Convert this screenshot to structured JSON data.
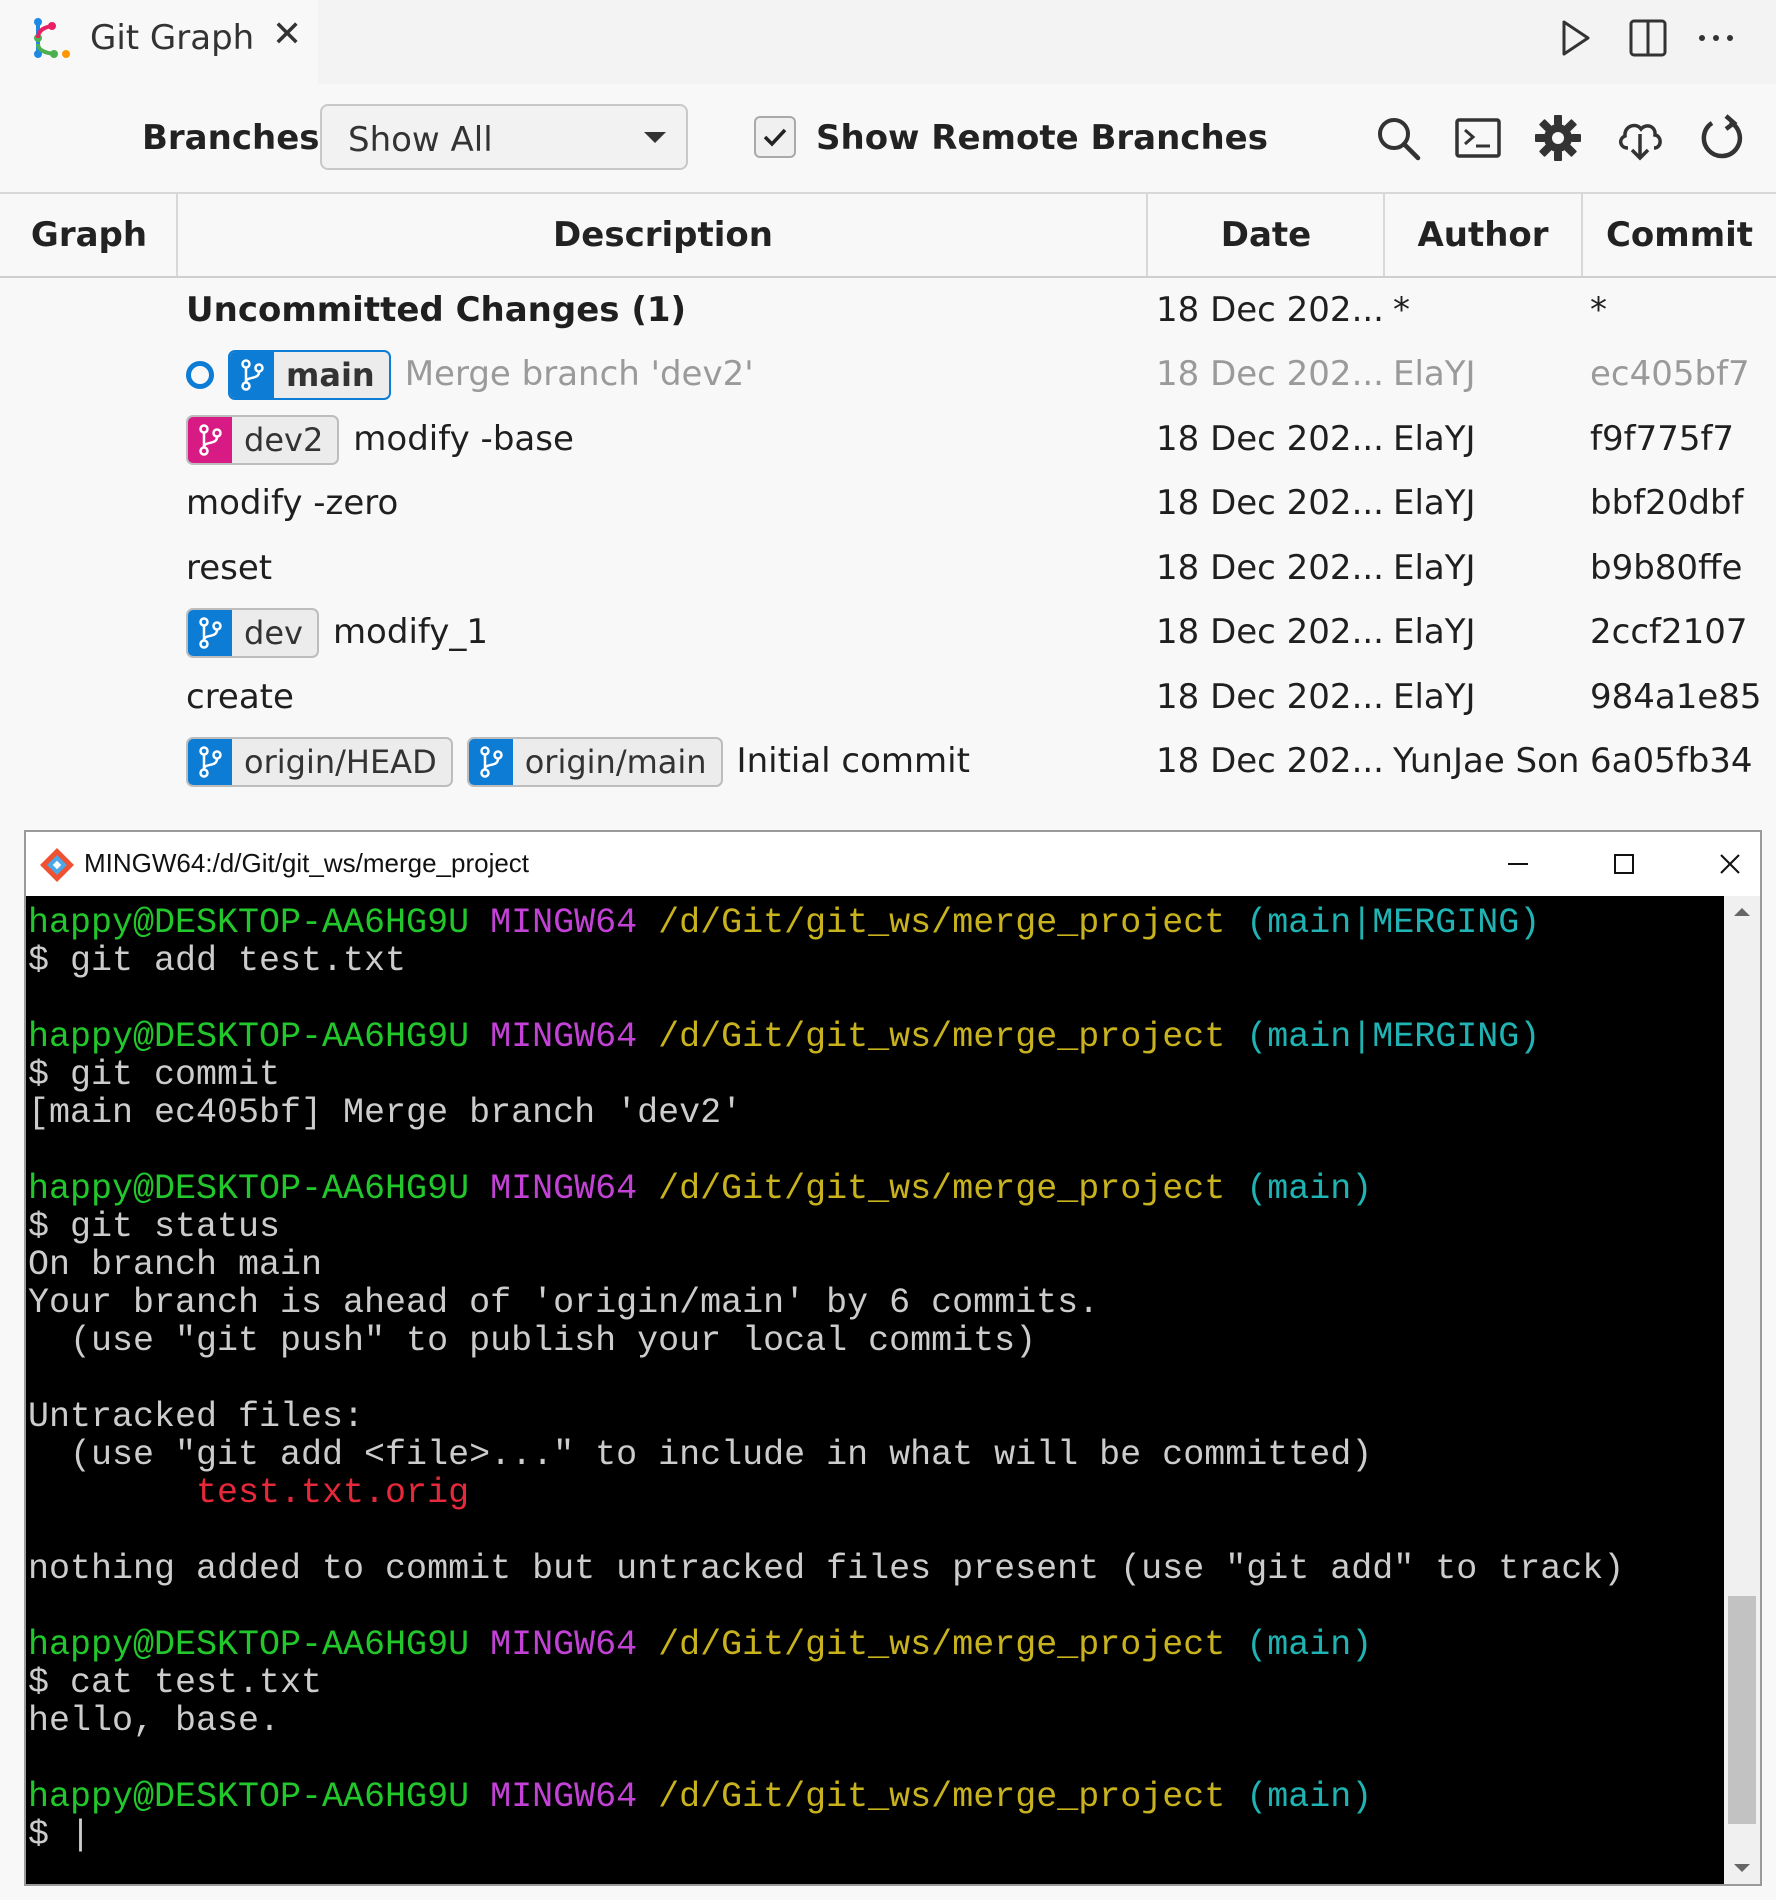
{
  "tab": {
    "title": "Git Graph"
  },
  "controls": {
    "branches_label": "Branches:",
    "branch_select_value": "Show All",
    "show_remote_label": "Show Remote Branches",
    "show_remote_checked": true
  },
  "table": {
    "headers": {
      "graph": "Graph",
      "description": "Description",
      "date": "Date",
      "author": "Author",
      "commit": "Commit"
    },
    "rows": [
      {
        "description": "Uncommitted Changes (1)",
        "date": "18 Dec 202...",
        "author": "*",
        "commit": "*"
      },
      {
        "refs": [
          "main"
        ],
        "description": "Merge branch 'dev2'",
        "date": "18 Dec 202...",
        "author": "ElaYJ",
        "commit": "ec405bf7"
      },
      {
        "refs": [
          "dev2"
        ],
        "description": "modify -base",
        "date": "18 Dec 202...",
        "author": "ElaYJ",
        "commit": "f9f775f7"
      },
      {
        "description": "modify -zero",
        "date": "18 Dec 202...",
        "author": "ElaYJ",
        "commit": "bbf20dbf"
      },
      {
        "description": "reset",
        "date": "18 Dec 202...",
        "author": "ElaYJ",
        "commit": "b9b80ffe"
      },
      {
        "refs": [
          "dev"
        ],
        "description": "modify_1",
        "date": "18 Dec 202...",
        "author": "ElaYJ",
        "commit": "2ccf2107"
      },
      {
        "description": "create",
        "date": "18 Dec 202...",
        "author": "ElaYJ",
        "commit": "984a1e85"
      },
      {
        "refs": [
          "origin/HEAD",
          "origin/main"
        ],
        "description": "Initial commit",
        "date": "18 Dec 202...",
        "author": "YunJae Son",
        "commit": "6a05fb34"
      }
    ]
  },
  "terminal": {
    "title": "MINGW64:/d/Git/git_ws/merge_project",
    "prompt": {
      "user": "happy@DESKTOP-AA6HG9U",
      "shell": "MINGW64",
      "path": "/d/Git/git_ws/merge_project"
    },
    "lines": [
      {
        "kind": "prompt",
        "branch": "(main|MERGING)"
      },
      {
        "kind": "text",
        "text": "$ git add test.txt"
      },
      {
        "kind": "blank"
      },
      {
        "kind": "prompt",
        "branch": "(main|MERGING)"
      },
      {
        "kind": "text",
        "text": "$ git commit"
      },
      {
        "kind": "text",
        "text": "[main ec405bf] Merge branch 'dev2'"
      },
      {
        "kind": "blank"
      },
      {
        "kind": "prompt",
        "branch": "(main)"
      },
      {
        "kind": "text",
        "text": "$ git status"
      },
      {
        "kind": "text",
        "text": "On branch main"
      },
      {
        "kind": "text",
        "text": "Your branch is ahead of 'origin/main' by 6 commits."
      },
      {
        "kind": "text",
        "text": "  (use \"git push\" to publish your local commits)"
      },
      {
        "kind": "blank"
      },
      {
        "kind": "text",
        "text": "Untracked files:"
      },
      {
        "kind": "text",
        "text": "  (use \"git add <file>...\" to include in what will be committed)"
      },
      {
        "kind": "red",
        "text": "        test.txt.orig"
      },
      {
        "kind": "blank"
      },
      {
        "kind": "text",
        "text": "nothing added to commit but untracked files present (use \"git add\" to track)"
      },
      {
        "kind": "blank"
      },
      {
        "kind": "prompt",
        "branch": "(main)"
      },
      {
        "kind": "text",
        "text": "$ cat test.txt"
      },
      {
        "kind": "text",
        "text": "hello, base."
      },
      {
        "kind": "blank"
      },
      {
        "kind": "prompt",
        "branch": "(main)"
      },
      {
        "kind": "text",
        "text": "$ |"
      }
    ]
  },
  "colors": {
    "branch_main": "#0c7cd5",
    "branch_dev2": "#d81b84",
    "uncommitted": "#808080",
    "term_user": "#22c72b",
    "term_shell": "#c342d6",
    "term_path": "#c8b31e",
    "term_branch": "#1fb3b3",
    "term_untracked": "#e5283a"
  },
  "icons": {
    "tab": "git-graph-icon",
    "tab_actions": [
      "run-icon",
      "split-editor-icon",
      "more-icon"
    ],
    "toolbar": [
      "search-icon",
      "terminal-icon",
      "gear-icon",
      "cloud-fetch-icon",
      "refresh-icon"
    ],
    "ref": "branch-icon"
  }
}
